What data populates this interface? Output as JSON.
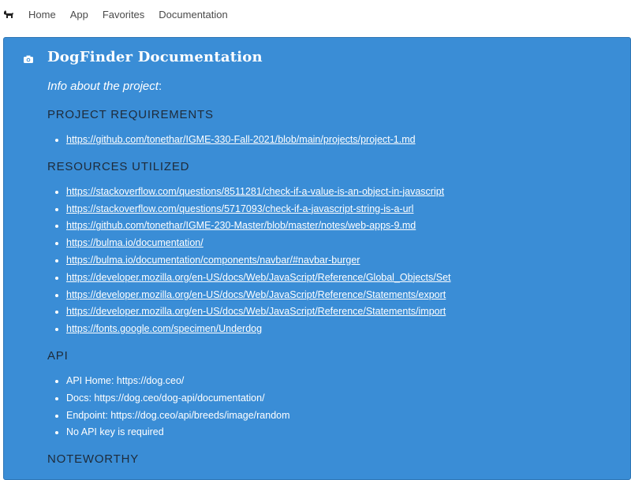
{
  "navbar": {
    "logo_icon": "dog-icon",
    "items": [
      "Home",
      "App",
      "Favorites",
      "Documentation"
    ]
  },
  "panel": {
    "icon": "camera-icon",
    "title": "DogFinder Documentation",
    "subtitle": "Info about the project",
    "subtitle_suffix": ":",
    "background_color": "#3a8dd6",
    "sections": {
      "requirements": {
        "heading": "PROJECT REQUIREMENTS",
        "links": [
          "https://github.com/tonethar/IGME-330-Fall-2021/blob/main/projects/project-1.md"
        ]
      },
      "resources": {
        "heading": "RESOURCES UTILIZED",
        "links": [
          "https://stackoverflow.com/questions/8511281/check-if-a-value-is-an-object-in-javascript",
          "https://stackoverflow.com/questions/5717093/check-if-a-javascript-string-is-a-url",
          "https://github.com/tonethar/IGME-230-Master/blob/master/notes/web-apps-9.md",
          "https://bulma.io/documentation/",
          "https://bulma.io/documentation/components/navbar/#navbar-burger",
          "https://developer.mozilla.org/en-US/docs/Web/JavaScript/Reference/Global_Objects/Set",
          "https://developer.mozilla.org/en-US/docs/Web/JavaScript/Reference/Statements/export",
          "https://developer.mozilla.org/en-US/docs/Web/JavaScript/Reference/Statements/import",
          "https://fonts.google.com/specimen/Underdog"
        ]
      },
      "api": {
        "heading": "API",
        "items": [
          "API Home: https://dog.ceo/",
          "Docs: https://dog.ceo/dog-api/documentation/",
          "Endpoint: https://dog.ceo/api/breeds/image/random",
          "No API key is required"
        ]
      },
      "noteworthy": {
        "heading": "NOTEWORTHY"
      }
    }
  }
}
